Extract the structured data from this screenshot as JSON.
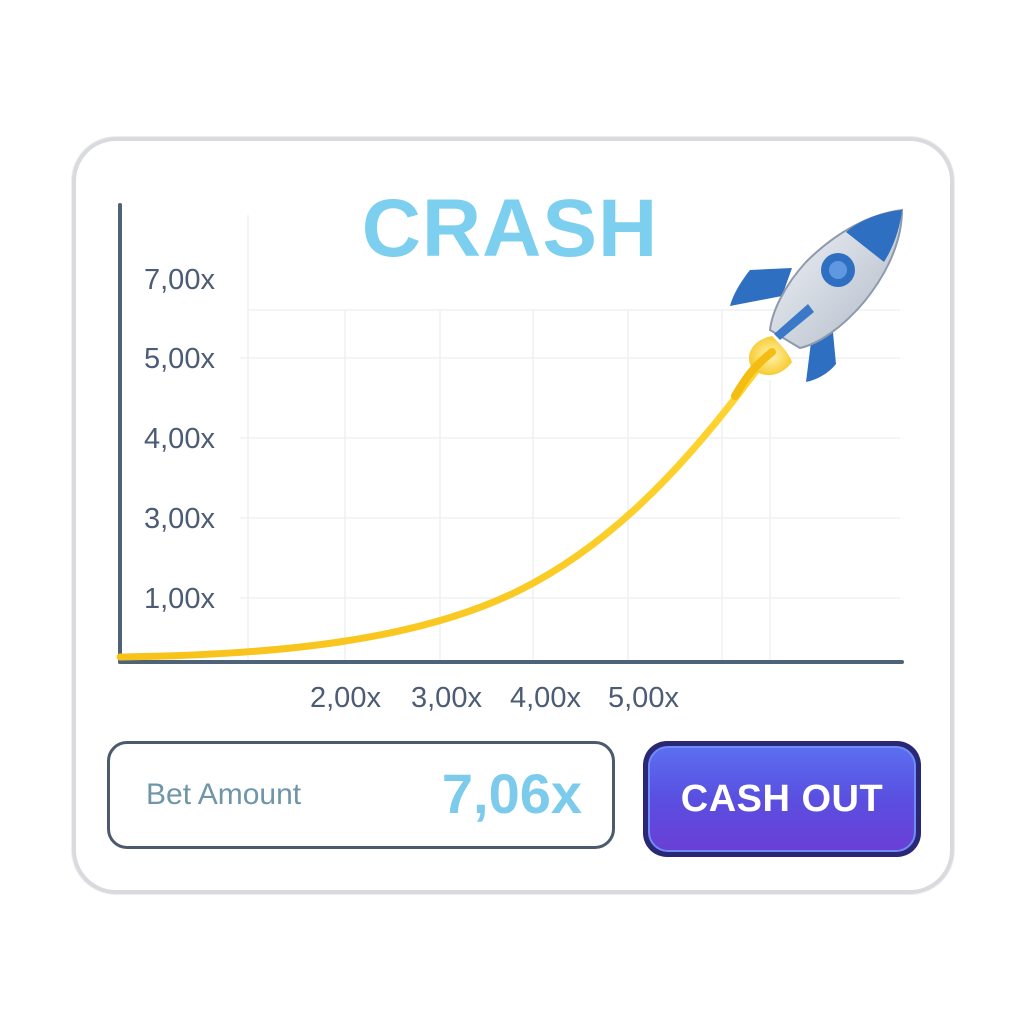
{
  "game": {
    "title": "CRASH"
  },
  "chart_data": {
    "type": "line",
    "y_tick_labels": [
      "7,00x",
      "5,00x",
      "4,00x",
      "3,00x",
      "1,00x"
    ],
    "x_tick_labels": [
      "2,00x",
      "3,00x",
      "4,00x",
      "5,00x"
    ],
    "grid": true,
    "line_color": "#f5c518"
  },
  "bet": {
    "label": "Bet Amount",
    "multiplier": "7,06x"
  },
  "actions": {
    "cash_out_label": "CASH OUT"
  },
  "icons": {
    "rocket": "rocket-icon"
  },
  "colors": {
    "title": "#7ccfee",
    "axis": "#4f6378",
    "curve": "#f5c518",
    "button": "#5a4fe0"
  }
}
